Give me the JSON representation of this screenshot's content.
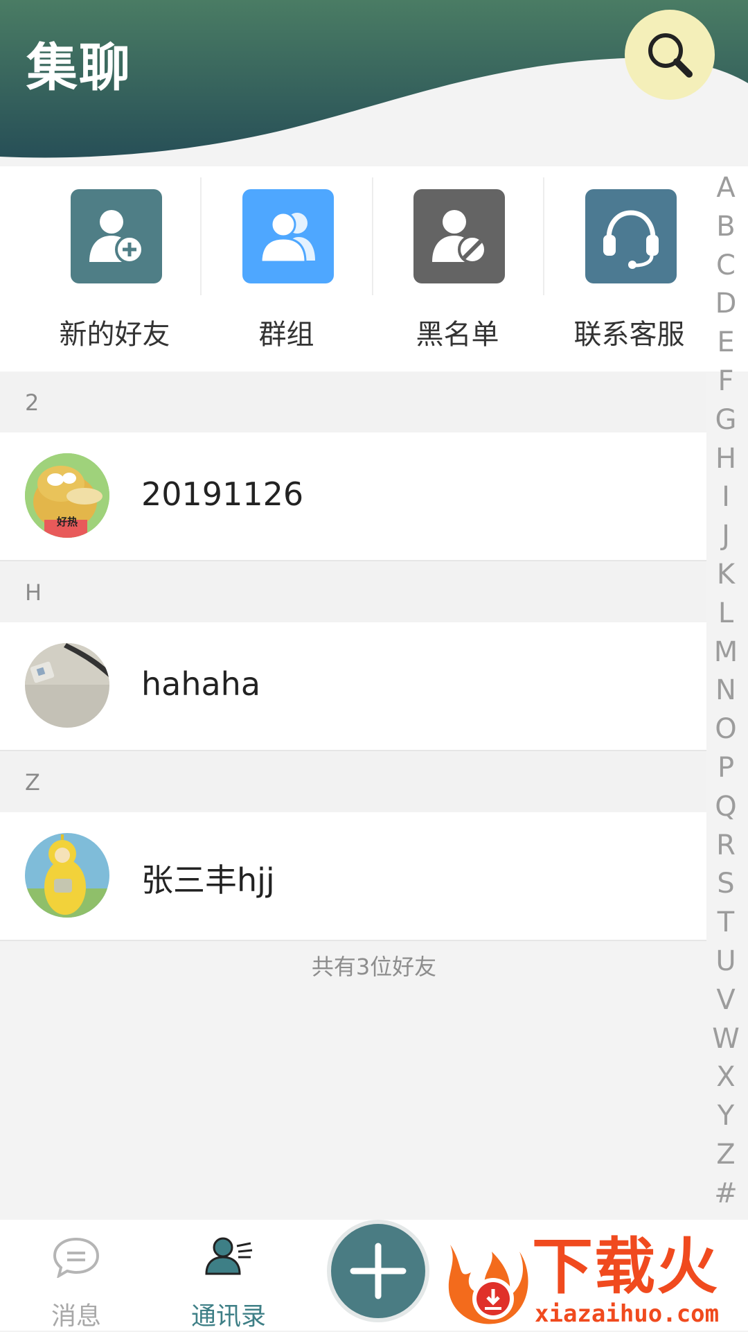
{
  "header": {
    "title": "集聊",
    "search_icon": "search-icon"
  },
  "actions": [
    {
      "label": "新的好友",
      "icon": "add-friend-icon",
      "color": "#4f7e86"
    },
    {
      "label": "群组",
      "icon": "group-icon",
      "color": "#4ea7ff"
    },
    {
      "label": "黑名单",
      "icon": "blacklist-icon",
      "color": "#646464"
    },
    {
      "label": "联系客服",
      "icon": "headset-icon",
      "color": "#4c7a92"
    }
  ],
  "sections": [
    {
      "letter": "2",
      "contacts": [
        {
          "name": "20191126",
          "avatar": "duck-avatar"
        }
      ]
    },
    {
      "letter": "H",
      "contacts": [
        {
          "name": "hahaha",
          "avatar": "desk-photo-avatar"
        }
      ]
    },
    {
      "letter": "Z",
      "contacts": [
        {
          "name": "张三丰hjj",
          "avatar": "teletubby-avatar"
        }
      ]
    }
  ],
  "avatar_caption": "好热",
  "footer_count": "共有3位好友",
  "index_letters": [
    "A",
    "B",
    "C",
    "D",
    "E",
    "F",
    "G",
    "H",
    "I",
    "J",
    "K",
    "L",
    "M",
    "N",
    "O",
    "P",
    "Q",
    "R",
    "S",
    "T",
    "U",
    "V",
    "W",
    "X",
    "Y",
    "Z",
    "#"
  ],
  "bottom_nav": {
    "messages_label": "消息",
    "contacts_label": "通讯录",
    "active_color": "#3e7f86",
    "inactive_color": "#a8a8a8"
  },
  "watermark": {
    "brand": "下载火",
    "url": "xiazaihuo.com"
  }
}
